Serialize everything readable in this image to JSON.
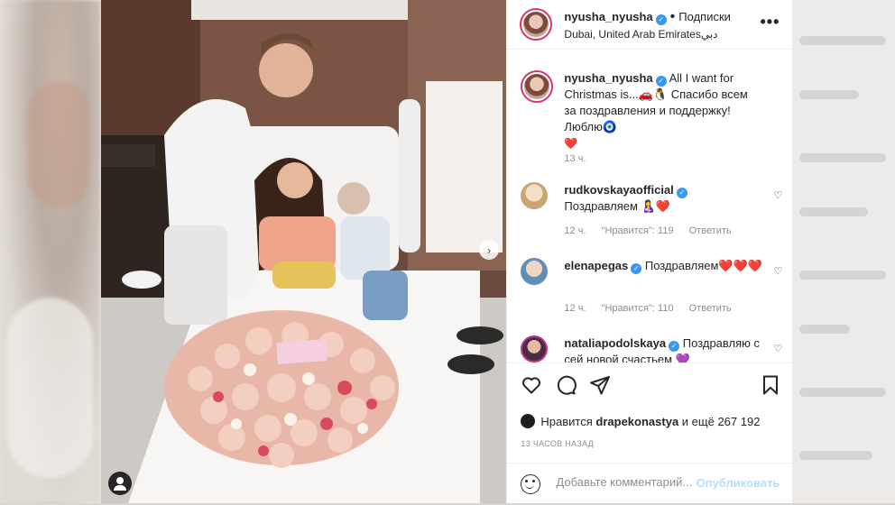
{
  "post": {
    "author": "nyusha_nyusha",
    "follow_label": "Подписки",
    "location": "Dubai, United Arab Emiratesدبي",
    "more_label": "•••"
  },
  "caption": {
    "author": "nyusha_nyusha",
    "text": "All I want for Christmas is...🚗🐧 Спасибо всем за поздравления и поддержку! Люблю🧿",
    "heart": "❤️",
    "time": "13 ч."
  },
  "comments": [
    {
      "author": "rudkovskaya.official",
      "display_author": "rudkovskayaofficial",
      "text": "Поздравляем 🤱❤️",
      "time": "12 ч.",
      "likes": "\"Нравится\": 119",
      "reply": "Ответить"
    },
    {
      "author": "elenapegas",
      "text": "Поздравляем❤️❤️❤️",
      "time": "12 ч.",
      "likes": "\"Нравится\": 110",
      "reply": "Ответить"
    },
    {
      "author": "nataliapodolskaya",
      "text": "Поздравляю с сей новой счастьем 💜",
      "time": "",
      "likes": "",
      "reply": ""
    }
  ],
  "likes": {
    "prefix": "Нравится",
    "user": "drapekonastya",
    "suffix": "и ещё 267 192"
  },
  "timestamp": "13 ЧАСОВ НАЗАД",
  "add_comment": {
    "placeholder": "Добавьте комментарий...",
    "publish_label": "Опубликовать"
  },
  "icons": {
    "like": "heart-icon",
    "comment": "comment-icon",
    "share": "send-icon",
    "save": "bookmark-icon",
    "emoji": "emoji-icon",
    "next": "chevron-right-icon",
    "tag": "user-tag-icon"
  },
  "colors": {
    "verified": "#3897f0",
    "publish_disabled": "#b2dffc",
    "meta_gray": "#8e8e8e"
  }
}
